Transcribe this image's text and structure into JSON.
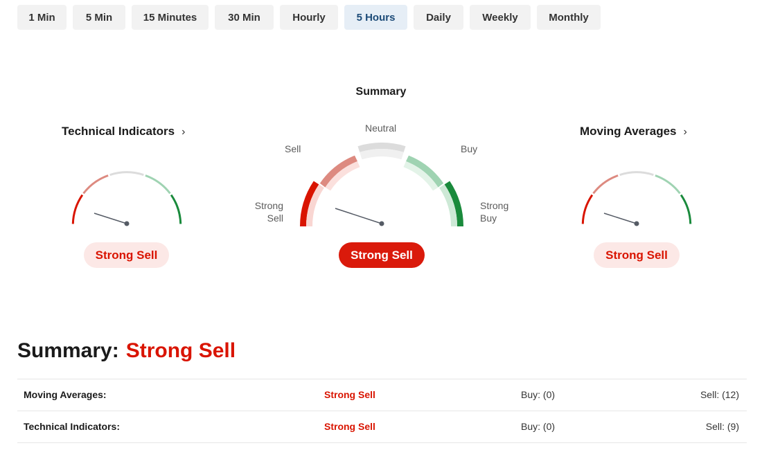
{
  "tabs": [
    {
      "label": "1 Min",
      "active": false
    },
    {
      "label": "5 Min",
      "active": false
    },
    {
      "label": "15 Minutes",
      "active": false
    },
    {
      "label": "30 Min",
      "active": false
    },
    {
      "label": "Hourly",
      "active": false
    },
    {
      "label": "5 Hours",
      "active": true
    },
    {
      "label": "Daily",
      "active": false
    },
    {
      "label": "Weekly",
      "active": false
    },
    {
      "label": "Monthly",
      "active": false
    }
  ],
  "gauges": {
    "technical": {
      "title": "Technical Indicators",
      "chevron": "chevron-right-icon",
      "result": "Strong Sell"
    },
    "summary": {
      "title": "Summary",
      "result": "Strong Sell",
      "labels": {
        "strong_sell": "Strong Sell",
        "sell": "Sell",
        "neutral": "Neutral",
        "buy": "Buy",
        "strong_buy": "Strong Buy"
      }
    },
    "moving": {
      "title": "Moving Averages",
      "chevron": "chevron-right-icon",
      "result": "Strong Sell"
    }
  },
  "summary": {
    "label": "Summary:",
    "value": "Strong Sell"
  },
  "table": [
    {
      "name": "Moving Averages:",
      "signal": "Strong Sell",
      "buy": "Buy: (0)",
      "sell": "Sell: (12)"
    },
    {
      "name": "Technical Indicators:",
      "signal": "Strong Sell",
      "buy": "Buy: (0)",
      "sell": "Sell: (9)"
    }
  ],
  "colors": {
    "strong_sell": "#d91400",
    "sell": "#dd8a80",
    "neutral": "#dcdcdc",
    "buy": "#9fd3b2",
    "strong_buy": "#1a8a3c",
    "active_tab_bg": "#e6eef6",
    "active_tab_text": "#1c4b78"
  }
}
